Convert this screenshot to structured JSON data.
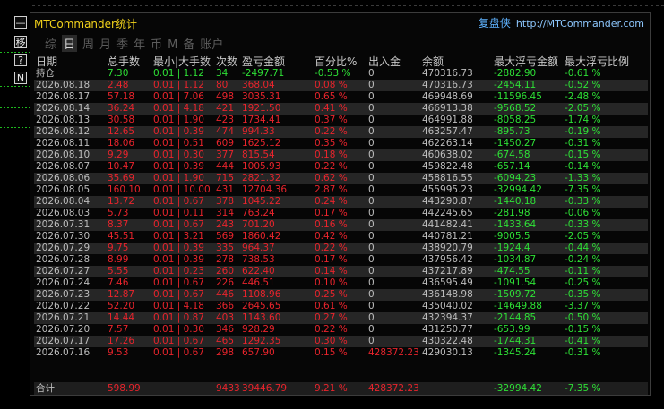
{
  "window": {
    "title": "MTCommander统计",
    "brand": "复盘侠",
    "url": "http://MTCommander.com"
  },
  "left_panel": {
    "buttons": [
      "—",
      "移",
      "?",
      "N"
    ]
  },
  "tabs": [
    "综",
    "日",
    "周",
    "月",
    "季",
    "年",
    "币",
    "M",
    "备",
    "账户"
  ],
  "active_tab": "日",
  "headers": [
    "日期",
    "总手数",
    "最小|大手数",
    "次数",
    "盈亏金额",
    "百分比%",
    "出入金",
    "余额",
    "最大浮亏金额",
    "最大浮亏比例"
  ],
  "holding": {
    "label": "持仓",
    "lots": "7.30",
    "minmax": "0.01 | 1.12",
    "count": "34",
    "pnl": "-2497.71",
    "pct": "-0.53 %",
    "inout": "0",
    "balance": "470316.73",
    "max_float": "-2882.90",
    "max_float_pct": "-0.61 %"
  },
  "rows": [
    {
      "date": "2026.08.18",
      "lots": "2.48",
      "minmax": "0.01 | 1.12",
      "count": "80",
      "pnl": "368.04",
      "pct": "0.08 %",
      "inout": "0",
      "balance": "470316.73",
      "max_float": "-2454.11",
      "max_float_pct": "-0.52 %"
    },
    {
      "date": "2026.08.17",
      "lots": "57.18",
      "minmax": "0.01 | 7.06",
      "count": "498",
      "pnl": "3035.31",
      "pct": "0.65 %",
      "inout": "0",
      "balance": "469948.69",
      "max_float": "-11596.45",
      "max_float_pct": "-2.48 %"
    },
    {
      "date": "2026.08.14",
      "lots": "36.24",
      "minmax": "0.01 | 4.18",
      "count": "421",
      "pnl": "1921.50",
      "pct": "0.41 %",
      "inout": "0",
      "balance": "466913.38",
      "max_float": "-9568.52",
      "max_float_pct": "-2.05 %"
    },
    {
      "date": "2026.08.13",
      "lots": "30.58",
      "minmax": "0.01 | 1.90",
      "count": "423",
      "pnl": "1734.41",
      "pct": "0.37 %",
      "inout": "0",
      "balance": "464991.88",
      "max_float": "-8058.25",
      "max_float_pct": "-1.74 %"
    },
    {
      "date": "2026.08.12",
      "lots": "12.65",
      "minmax": "0.01 | 0.39",
      "count": "474",
      "pnl": "994.33",
      "pct": "0.22 %",
      "inout": "0",
      "balance": "463257.47",
      "max_float": "-895.73",
      "max_float_pct": "-0.19 %"
    },
    {
      "date": "2026.08.11",
      "lots": "18.06",
      "minmax": "0.01 | 0.51",
      "count": "609",
      "pnl": "1625.12",
      "pct": "0.35 %",
      "inout": "0",
      "balance": "462263.14",
      "max_float": "-1450.27",
      "max_float_pct": "-0.31 %"
    },
    {
      "date": "2026.08.10",
      "lots": "9.29",
      "minmax": "0.01 | 0.30",
      "count": "377",
      "pnl": "815.54",
      "pct": "0.18 %",
      "inout": "0",
      "balance": "460638.02",
      "max_float": "-674.58",
      "max_float_pct": "-0.15 %"
    },
    {
      "date": "2026.08.07",
      "lots": "10.47",
      "minmax": "0.01 | 0.39",
      "count": "444",
      "pnl": "1005.93",
      "pct": "0.22 %",
      "inout": "0",
      "balance": "459822.48",
      "max_float": "-657.14",
      "max_float_pct": "-0.14 %"
    },
    {
      "date": "2026.08.06",
      "lots": "35.69",
      "minmax": "0.01 | 1.90",
      "count": "715",
      "pnl": "2821.32",
      "pct": "0.62 %",
      "inout": "0",
      "balance": "458816.55",
      "max_float": "-6094.23",
      "max_float_pct": "-1.33 %"
    },
    {
      "date": "2026.08.05",
      "lots": "160.10",
      "minmax": "0.01 | 10.00",
      "count": "431",
      "pnl": "12704.36",
      "pct": "2.87 %",
      "inout": "0",
      "balance": "455995.23",
      "max_float": "-32994.42",
      "max_float_pct": "-7.35 %"
    },
    {
      "date": "2026.08.04",
      "lots": "13.72",
      "minmax": "0.01 | 0.67",
      "count": "378",
      "pnl": "1045.22",
      "pct": "0.24 %",
      "inout": "0",
      "balance": "443290.87",
      "max_float": "-1440.18",
      "max_float_pct": "-0.33 %"
    },
    {
      "date": "2026.08.03",
      "lots": "5.73",
      "minmax": "0.01 | 0.11",
      "count": "314",
      "pnl": "763.24",
      "pct": "0.17 %",
      "inout": "0",
      "balance": "442245.65",
      "max_float": "-281.98",
      "max_float_pct": "-0.06 %"
    },
    {
      "date": "2026.07.31",
      "lots": "8.37",
      "minmax": "0.01 | 0.67",
      "count": "243",
      "pnl": "701.20",
      "pct": "0.16 %",
      "inout": "0",
      "balance": "441482.41",
      "max_float": "-1433.64",
      "max_float_pct": "-0.33 %"
    },
    {
      "date": "2026.07.30",
      "lots": "45.51",
      "minmax": "0.01 | 3.21",
      "count": "569",
      "pnl": "1860.42",
      "pct": "0.42 %",
      "inout": "0",
      "balance": "440781.21",
      "max_float": "-9005.5",
      "max_float_pct": "-2.05 %"
    },
    {
      "date": "2026.07.29",
      "lots": "9.75",
      "minmax": "0.01 | 0.39",
      "count": "335",
      "pnl": "964.37",
      "pct": "0.22 %",
      "inout": "0",
      "balance": "438920.79",
      "max_float": "-1924.4",
      "max_float_pct": "-0.44 %"
    },
    {
      "date": "2026.07.28",
      "lots": "8.99",
      "minmax": "0.01 | 0.39",
      "count": "278",
      "pnl": "738.53",
      "pct": "0.17 %",
      "inout": "0",
      "balance": "437956.42",
      "max_float": "-1034.87",
      "max_float_pct": "-0.24 %"
    },
    {
      "date": "2026.07.27",
      "lots": "5.55",
      "minmax": "0.01 | 0.23",
      "count": "260",
      "pnl": "622.40",
      "pct": "0.14 %",
      "inout": "0",
      "balance": "437217.89",
      "max_float": "-474.55",
      "max_float_pct": "-0.11 %"
    },
    {
      "date": "2026.07.24",
      "lots": "7.46",
      "minmax": "0.01 | 0.67",
      "count": "226",
      "pnl": "446.51",
      "pct": "0.10 %",
      "inout": "0",
      "balance": "436595.49",
      "max_float": "-1091.54",
      "max_float_pct": "-0.25 %"
    },
    {
      "date": "2026.07.23",
      "lots": "12.87",
      "minmax": "0.01 | 0.67",
      "count": "446",
      "pnl": "1108.96",
      "pct": "0.25 %",
      "inout": "0",
      "balance": "436148.98",
      "max_float": "-1509.72",
      "max_float_pct": "-0.35 %"
    },
    {
      "date": "2026.07.22",
      "lots": "52.20",
      "minmax": "0.01 | 4.18",
      "count": "366",
      "pnl": "2645.65",
      "pct": "0.61 %",
      "inout": "0",
      "balance": "435040.02",
      "max_float": "-14649.88",
      "max_float_pct": "-3.37 %"
    },
    {
      "date": "2026.07.21",
      "lots": "14.44",
      "minmax": "0.01 | 0.87",
      "count": "403",
      "pnl": "1143.60",
      "pct": "0.27 %",
      "inout": "0",
      "balance": "432394.37",
      "max_float": "-2144.85",
      "max_float_pct": "-0.50 %"
    },
    {
      "date": "2026.07.20",
      "lots": "7.57",
      "minmax": "0.01 | 0.30",
      "count": "346",
      "pnl": "928.29",
      "pct": "0.22 %",
      "inout": "0",
      "balance": "431250.77",
      "max_float": "-653.99",
      "max_float_pct": "-0.15 %"
    },
    {
      "date": "2026.07.17",
      "lots": "17.26",
      "minmax": "0.01 | 0.67",
      "count": "465",
      "pnl": "1292.35",
      "pct": "0.30 %",
      "inout": "0",
      "balance": "430322.48",
      "max_float": "-1744.31",
      "max_float_pct": "-0.41 %"
    },
    {
      "date": "2026.07.16",
      "lots": "9.53",
      "minmax": "0.01 | 0.67",
      "count": "298",
      "pnl": "657.90",
      "pct": "0.15 %",
      "inout": "428372.23",
      "balance": "429030.13",
      "max_float": "-1345.24",
      "max_float_pct": "-0.31 %"
    }
  ],
  "total": {
    "label": "合计",
    "lots": "598.99",
    "minmax": "",
    "count": "9433",
    "pnl": "39446.79",
    "pct": "9.21 %",
    "inout": "428372.23",
    "balance": "",
    "max_float": "-32994.42",
    "max_float_pct": "-7.35 %"
  },
  "colors": {
    "positive_text": "#e8242c",
    "negative_text": "#2ee036",
    "title": "#f2d21b",
    "brand": "#5fb3ff"
  }
}
